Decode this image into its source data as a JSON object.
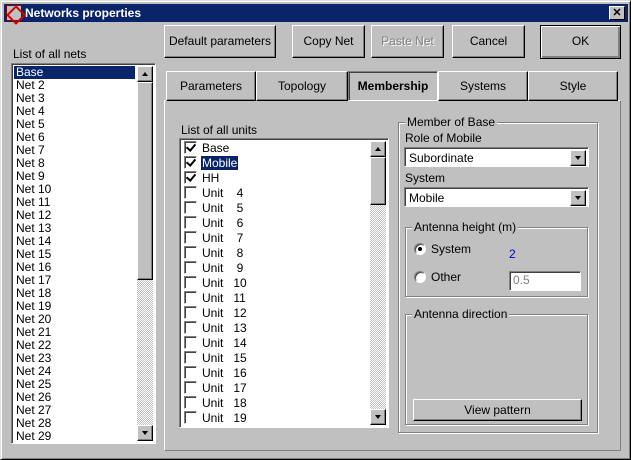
{
  "window": {
    "title": "Networks properties",
    "close_glyph": "✕"
  },
  "toolbar": {
    "default_parameters": "Default parameters",
    "copy_net": "Copy Net",
    "paste_net": "Paste Net",
    "cancel": "Cancel",
    "ok": "OK"
  },
  "nets_list": {
    "label": "List of all nets",
    "items": [
      "Base",
      "Net  2",
      "Net  3",
      "Net  4",
      "Net  5",
      "Net  6",
      "Net  7",
      "Net  8",
      "Net  9",
      "Net 10",
      "Net 11",
      "Net 12",
      "Net 13",
      "Net 14",
      "Net 15",
      "Net 16",
      "Net 17",
      "Net 18",
      "Net 19",
      "Net 20",
      "Net 21",
      "Net 22",
      "Net 23",
      "Net 24",
      "Net 25",
      "Net 26",
      "Net 27",
      "Net 28",
      "Net 29"
    ],
    "selected": "Base"
  },
  "tabs": [
    "Parameters",
    "Topology",
    "Membership",
    "Systems",
    "Style"
  ],
  "active_tab": "Membership",
  "units_list": {
    "label": "List of all units",
    "items": [
      {
        "name": "Base",
        "checked": true
      },
      {
        "name": "Mobile",
        "checked": true,
        "selected": true
      },
      {
        "name": "HH",
        "checked": true
      },
      {
        "name": "Unit    4",
        "checked": false
      },
      {
        "name": "Unit    5",
        "checked": false
      },
      {
        "name": "Unit    6",
        "checked": false
      },
      {
        "name": "Unit    7",
        "checked": false
      },
      {
        "name": "Unit    8",
        "checked": false
      },
      {
        "name": "Unit    9",
        "checked": false
      },
      {
        "name": "Unit   10",
        "checked": false
      },
      {
        "name": "Unit   11",
        "checked": false
      },
      {
        "name": "Unit   12",
        "checked": false
      },
      {
        "name": "Unit   13",
        "checked": false
      },
      {
        "name": "Unit   14",
        "checked": false
      },
      {
        "name": "Unit   15",
        "checked": false
      },
      {
        "name": "Unit   16",
        "checked": false
      },
      {
        "name": "Unit   17",
        "checked": false
      },
      {
        "name": "Unit   18",
        "checked": false
      },
      {
        "name": "Unit   19",
        "checked": false
      }
    ]
  },
  "member": {
    "group_title": "Member of Base",
    "role_label": "Role of Mobile",
    "role_value": "Subordinate",
    "system_label": "System",
    "system_value": "Mobile",
    "antenna_height": {
      "title": "Antenna height (m)",
      "system_label": "System",
      "system_value": "2",
      "other_label": "Other",
      "other_value": "0.5",
      "selected": "System"
    },
    "antenna_direction": {
      "title": "Antenna direction",
      "view_pattern": "View pattern"
    }
  },
  "colors": {
    "face": "#c0c0c0",
    "title_bar": "#0a246a",
    "highlight": "#0a246a",
    "value_blue": "#0000c0"
  }
}
